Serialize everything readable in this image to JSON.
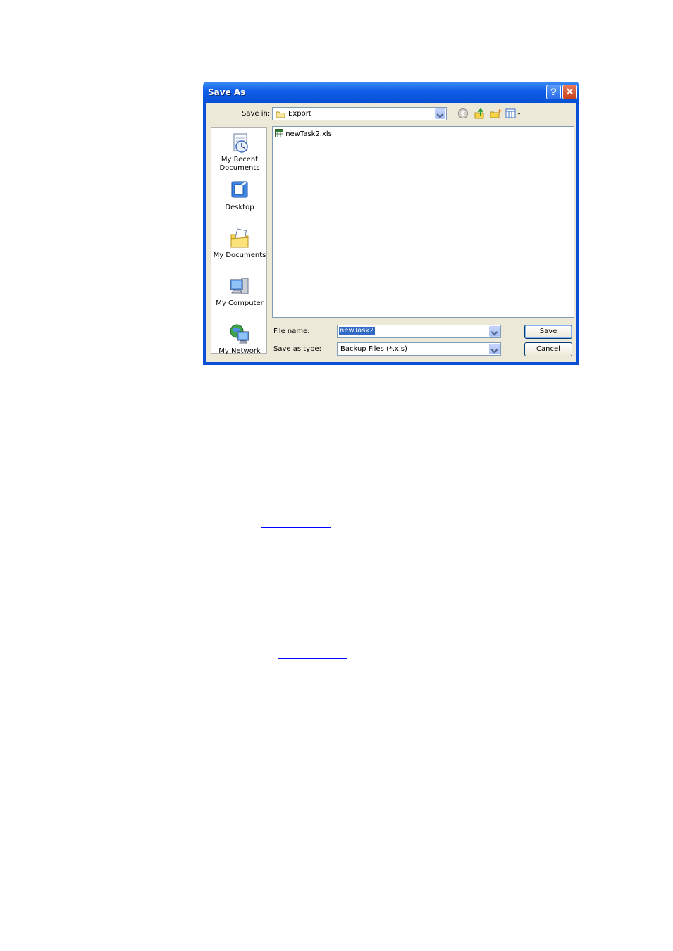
{
  "dialog": {
    "title": "Save As",
    "help_symbol": "?",
    "close_symbol": "✕"
  },
  "save_in": {
    "label": "Save in:",
    "value": "Export"
  },
  "places": [
    {
      "label": "My Recent Documents",
      "icon": "recent-documents-icon"
    },
    {
      "label": "Desktop",
      "icon": "desktop-icon"
    },
    {
      "label": "My Documents",
      "icon": "my-documents-icon"
    },
    {
      "label": "My Computer",
      "icon": "my-computer-icon"
    },
    {
      "label": "My Network",
      "icon": "my-network-icon"
    }
  ],
  "files": [
    {
      "name": "newTask2.xls",
      "icon": "spreadsheet-file-icon"
    }
  ],
  "file_name": {
    "label": "File name:",
    "value": "newTask2"
  },
  "save_type": {
    "label": "Save as type:",
    "value": "Backup Files (*.xls)"
  },
  "buttons": {
    "save": "Save",
    "cancel": "Cancel"
  },
  "colors": {
    "titlebar": "#0a50d6",
    "selection": "#316ac5",
    "link": "#0000ff"
  }
}
